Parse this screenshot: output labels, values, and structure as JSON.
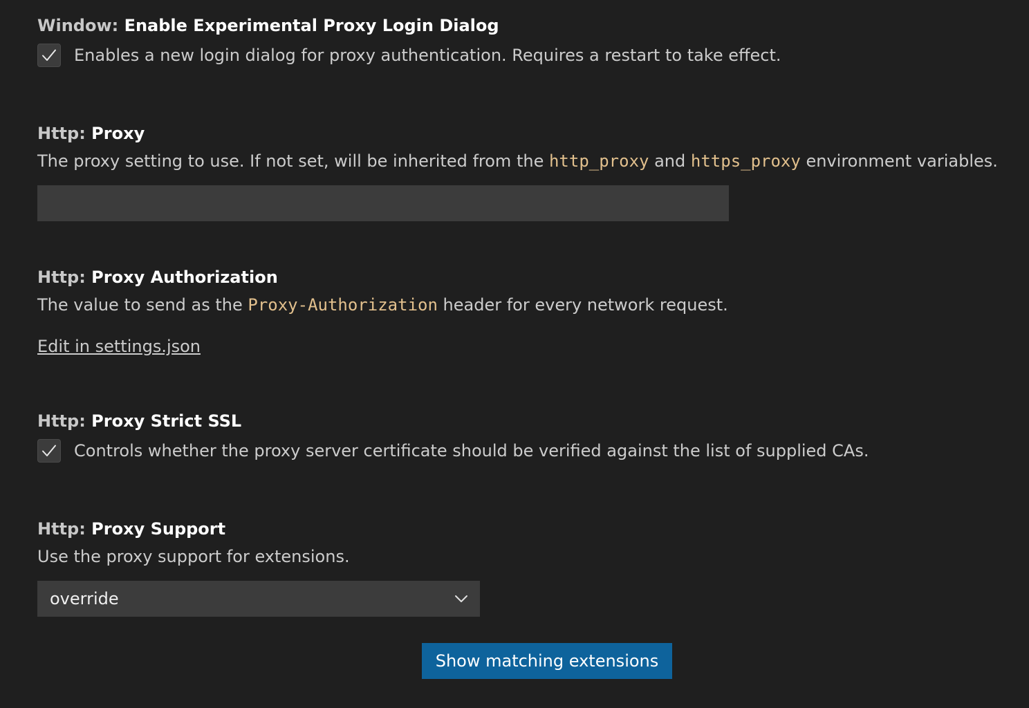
{
  "settings": {
    "proxy_login": {
      "category": "Window: ",
      "key": "Enable Experimental Proxy Login Dialog",
      "checked": true,
      "description": "Enables a new login dialog for proxy authentication. Requires a restart to take effect."
    },
    "proxy": {
      "category": "Http: ",
      "key": "Proxy",
      "desc_part1": "The proxy setting to use. If not set, will be inherited from the ",
      "desc_code1": "http_proxy",
      "desc_part2": " and ",
      "desc_code2": "https_proxy",
      "desc_part3": " environment variables.",
      "value": ""
    },
    "proxy_authorization": {
      "category": "Http: ",
      "key": "Proxy Authorization",
      "desc_part1": "The value to send as the ",
      "desc_code1": "Proxy-Authorization",
      "desc_part2": " header for every network request.",
      "link_label": "Edit in settings.json"
    },
    "proxy_strict_ssl": {
      "category": "Http: ",
      "key": "Proxy Strict SSL",
      "checked": true,
      "description": "Controls whether the proxy server certificate should be verified against the list of supplied CAs."
    },
    "proxy_support": {
      "category": "Http: ",
      "key": "Proxy Support",
      "description": "Use the proxy support for extensions.",
      "selected": "override"
    }
  },
  "actions": {
    "show_matching_extensions": "Show matching extensions"
  },
  "icons": {
    "checkbox": "check-icon",
    "dropdown": "chevron-down-icon"
  },
  "colors": {
    "background": "#1f1f1f",
    "code": "#e2c08d",
    "button": "#0e639c",
    "input": "#3c3c3c"
  }
}
